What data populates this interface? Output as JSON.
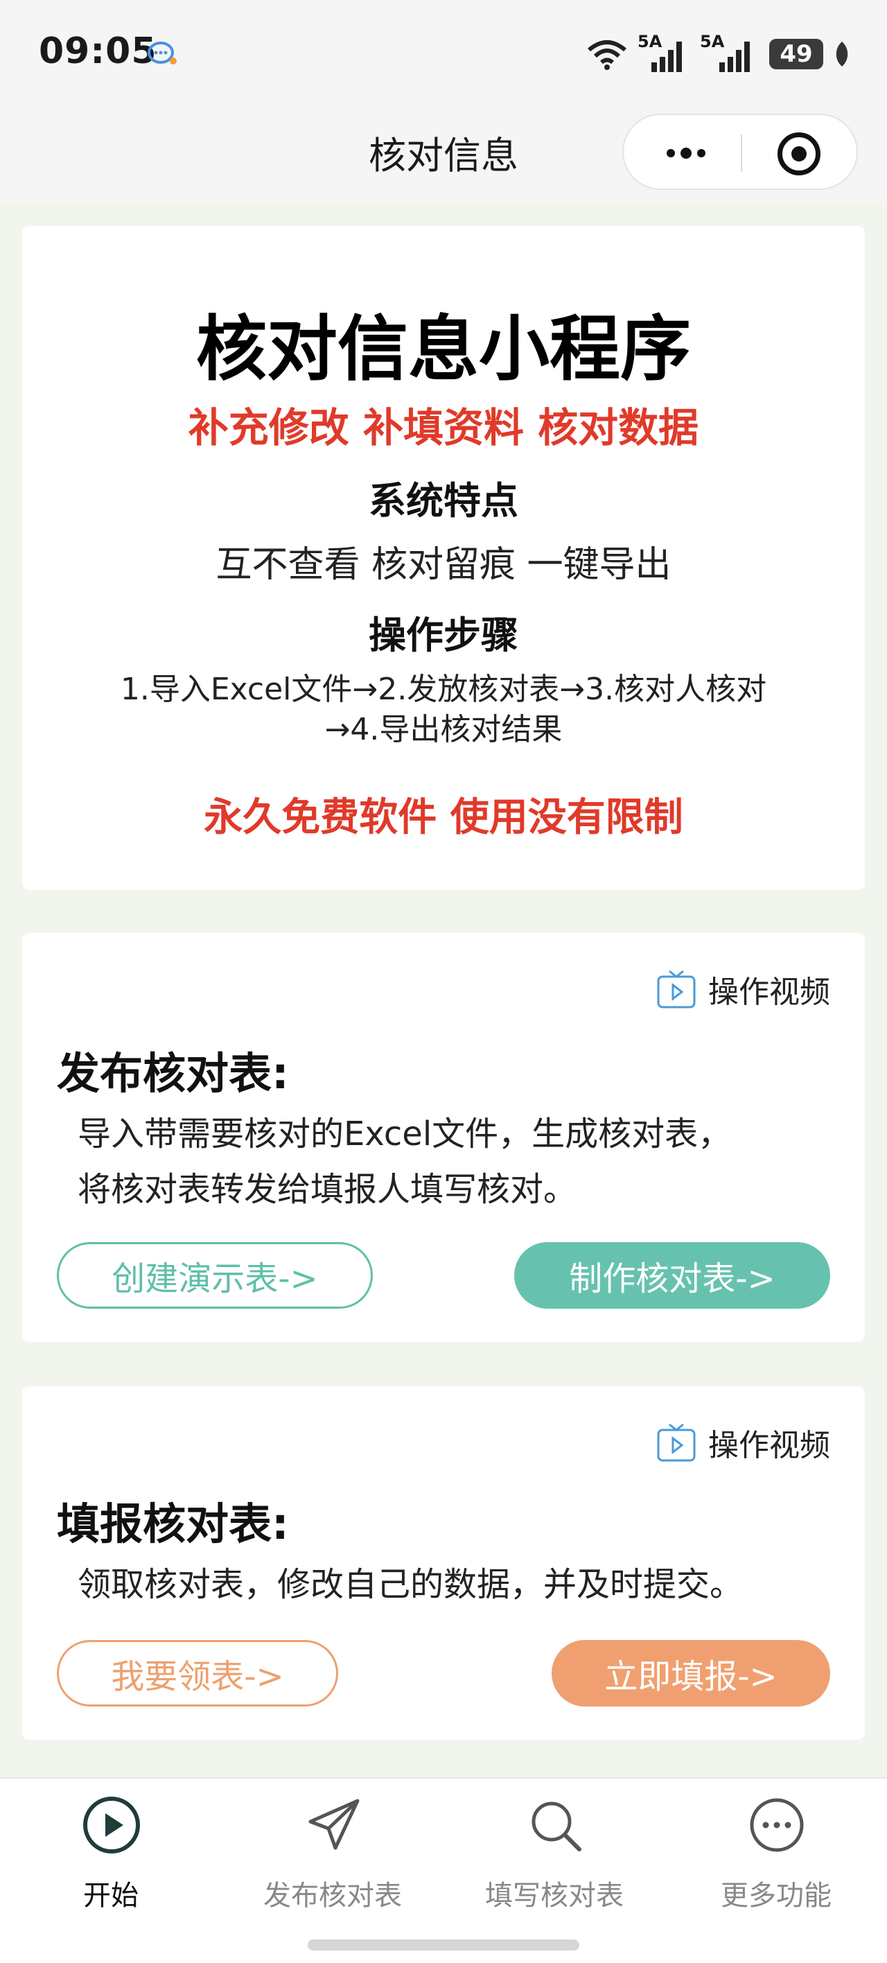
{
  "status_bar": {
    "time": "09:05",
    "network_1": "5A",
    "network_2": "5A",
    "battery": "49",
    "icons": [
      "chat-bubble-icon",
      "wifi-icon",
      "signal-icon",
      "battery-icon",
      "leaf-icon"
    ]
  },
  "nav": {
    "title": "核对信息",
    "icons": [
      "more-dots-icon",
      "target-icon"
    ]
  },
  "intro": {
    "title": "核对信息小程序",
    "subtitle": "补充修改 补填资料 核对数据",
    "features_title": "系统特点",
    "features": "互不查看 核对留痕 一键导出",
    "steps_title": "操作步骤",
    "steps_line1": "1.导入Excel文件→2.发放核对表→3.核对人核对",
    "steps_line2": "→4.导出核对结果",
    "free_note": "永久免费软件 使用没有限制"
  },
  "publish_card": {
    "video_label": "操作视频",
    "title": "发布核对表:",
    "desc_line1": "导入带需要核对的Excel文件，生成核对表，",
    "desc_line2": "将核对表转发给填报人填写核对。",
    "demo_button": "创建演示表->",
    "make_button": "制作核对表->",
    "accent_color": "#66c2ae"
  },
  "fill_card": {
    "video_label": "操作视频",
    "title": "填报核对表:",
    "desc": "领取核对表，修改自己的数据，并及时提交。",
    "claim_button": "我要领表->",
    "fill_button": "立即填报->",
    "accent_color": "#f0a070"
  },
  "tabs": [
    {
      "label": "开始",
      "icon": "play-circle-icon",
      "active": true
    },
    {
      "label": "发布核对表",
      "icon": "paper-plane-icon",
      "active": false
    },
    {
      "label": "填写核对表",
      "icon": "search-icon",
      "active": false
    },
    {
      "label": "更多功能",
      "icon": "more-circle-icon",
      "active": false
    }
  ]
}
